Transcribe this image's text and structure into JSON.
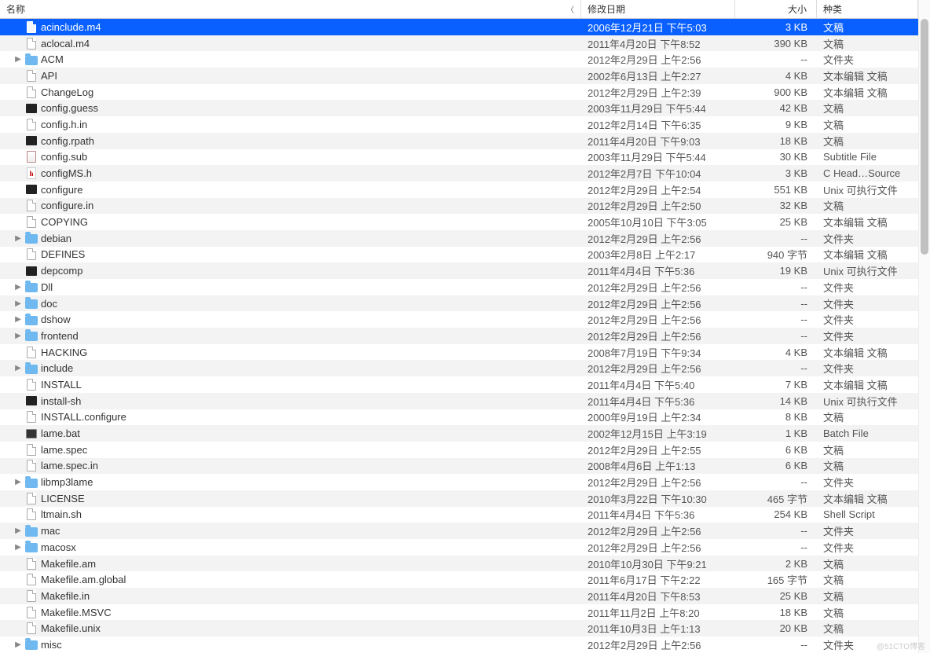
{
  "columns": {
    "name": "名称",
    "date": "修改日期",
    "size": "大小",
    "kind": "种类"
  },
  "watermark": "@51CTO博客",
  "files": [
    {
      "name": "acinclude.m4",
      "date": "2006年12月21日 下午5:03",
      "size": "3 KB",
      "kind": "文稿",
      "icon": "doc",
      "folder": false,
      "selected": true
    },
    {
      "name": "aclocal.m4",
      "date": "2011年4月20日 下午8:52",
      "size": "390 KB",
      "kind": "文稿",
      "icon": "doc",
      "folder": false
    },
    {
      "name": "ACM",
      "date": "2012年2月29日 上午2:56",
      "size": "--",
      "kind": "文件夹",
      "icon": "folder",
      "folder": true
    },
    {
      "name": "API",
      "date": "2002年6月13日 上午2:27",
      "size": "4 KB",
      "kind": "文本编辑 文稿",
      "icon": "doc",
      "folder": false
    },
    {
      "name": "ChangeLog",
      "date": "2012年2月29日 上午2:39",
      "size": "900 KB",
      "kind": "文本编辑 文稿",
      "icon": "doc",
      "folder": false
    },
    {
      "name": "config.guess",
      "date": "2003年11月29日 下午5:44",
      "size": "42 KB",
      "kind": "文稿",
      "icon": "exec",
      "folder": false
    },
    {
      "name": "config.h.in",
      "date": "2012年2月14日 下午6:35",
      "size": "9 KB",
      "kind": "文稿",
      "icon": "doc",
      "folder": false
    },
    {
      "name": "config.rpath",
      "date": "2011年4月20日 下午9:03",
      "size": "18 KB",
      "kind": "文稿",
      "icon": "exec",
      "folder": false
    },
    {
      "name": "config.sub",
      "date": "2003年11月29日 下午5:44",
      "size": "30 KB",
      "kind": "Subtitle File",
      "icon": "sub",
      "folder": false
    },
    {
      "name": "configMS.h",
      "date": "2012年2月7日 下午10:04",
      "size": "3 KB",
      "kind": "C Head…Source",
      "icon": "h",
      "folder": false
    },
    {
      "name": "configure",
      "date": "2012年2月29日 上午2:54",
      "size": "551 KB",
      "kind": "Unix 可执行文件",
      "icon": "exec",
      "folder": false
    },
    {
      "name": "configure.in",
      "date": "2012年2月29日 上午2:50",
      "size": "32 KB",
      "kind": "文稿",
      "icon": "doc",
      "folder": false
    },
    {
      "name": "COPYING",
      "date": "2005年10月10日 下午3:05",
      "size": "25 KB",
      "kind": "文本编辑 文稿",
      "icon": "doc",
      "folder": false
    },
    {
      "name": "debian",
      "date": "2012年2月29日 上午2:56",
      "size": "--",
      "kind": "文件夹",
      "icon": "folder",
      "folder": true
    },
    {
      "name": "DEFINES",
      "date": "2003年2月8日 上午2:17",
      "size": "940 字节",
      "kind": "文本编辑 文稿",
      "icon": "doc",
      "folder": false
    },
    {
      "name": "depcomp",
      "date": "2011年4月4日 下午5:36",
      "size": "19 KB",
      "kind": "Unix 可执行文件",
      "icon": "exec",
      "folder": false
    },
    {
      "name": "Dll",
      "date": "2012年2月29日 上午2:56",
      "size": "--",
      "kind": "文件夹",
      "icon": "folder",
      "folder": true
    },
    {
      "name": "doc",
      "date": "2012年2月29日 上午2:56",
      "size": "--",
      "kind": "文件夹",
      "icon": "folder",
      "folder": true
    },
    {
      "name": "dshow",
      "date": "2012年2月29日 上午2:56",
      "size": "--",
      "kind": "文件夹",
      "icon": "folder",
      "folder": true
    },
    {
      "name": "frontend",
      "date": "2012年2月29日 上午2:56",
      "size": "--",
      "kind": "文件夹",
      "icon": "folder",
      "folder": true
    },
    {
      "name": "HACKING",
      "date": "2008年7月19日 下午9:34",
      "size": "4 KB",
      "kind": "文本编辑 文稿",
      "icon": "doc",
      "folder": false
    },
    {
      "name": "include",
      "date": "2012年2月29日 上午2:56",
      "size": "--",
      "kind": "文件夹",
      "icon": "folder",
      "folder": true
    },
    {
      "name": "INSTALL",
      "date": "2011年4月4日 下午5:40",
      "size": "7 KB",
      "kind": "文本编辑 文稿",
      "icon": "doc",
      "folder": false
    },
    {
      "name": "install-sh",
      "date": "2011年4月4日 下午5:36",
      "size": "14 KB",
      "kind": "Unix 可执行文件",
      "icon": "exec",
      "folder": false
    },
    {
      "name": "INSTALL.configure",
      "date": "2000年9月19日 上午2:34",
      "size": "8 KB",
      "kind": "文稿",
      "icon": "doc",
      "folder": false
    },
    {
      "name": "lame.bat",
      "date": "2002年12月15日 上午3:19",
      "size": "1 KB",
      "kind": "Batch File",
      "icon": "bat",
      "folder": false
    },
    {
      "name": "lame.spec",
      "date": "2012年2月29日 上午2:55",
      "size": "6 KB",
      "kind": "文稿",
      "icon": "doc",
      "folder": false
    },
    {
      "name": "lame.spec.in",
      "date": "2008年4月6日 上午1:13",
      "size": "6 KB",
      "kind": "文稿",
      "icon": "doc",
      "folder": false
    },
    {
      "name": "libmp3lame",
      "date": "2012年2月29日 上午2:56",
      "size": "--",
      "kind": "文件夹",
      "icon": "folder",
      "folder": true
    },
    {
      "name": "LICENSE",
      "date": "2010年3月22日 下午10:30",
      "size": "465 字节",
      "kind": "文本编辑 文稿",
      "icon": "doc",
      "folder": false
    },
    {
      "name": "ltmain.sh",
      "date": "2011年4月4日 下午5:36",
      "size": "254 KB",
      "kind": "Shell Script",
      "icon": "doc",
      "folder": false
    },
    {
      "name": "mac",
      "date": "2012年2月29日 上午2:56",
      "size": "--",
      "kind": "文件夹",
      "icon": "folder",
      "folder": true
    },
    {
      "name": "macosx",
      "date": "2012年2月29日 上午2:56",
      "size": "--",
      "kind": "文件夹",
      "icon": "folder",
      "folder": true
    },
    {
      "name": "Makefile.am",
      "date": "2010年10月30日 下午9:21",
      "size": "2 KB",
      "kind": "文稿",
      "icon": "doc",
      "folder": false
    },
    {
      "name": "Makefile.am.global",
      "date": "2011年6月17日 下午2:22",
      "size": "165 字节",
      "kind": "文稿",
      "icon": "doc",
      "folder": false
    },
    {
      "name": "Makefile.in",
      "date": "2011年4月20日 下午8:53",
      "size": "25 KB",
      "kind": "文稿",
      "icon": "doc",
      "folder": false
    },
    {
      "name": "Makefile.MSVC",
      "date": "2011年11月2日 上午8:20",
      "size": "18 KB",
      "kind": "文稿",
      "icon": "doc",
      "folder": false
    },
    {
      "name": "Makefile.unix",
      "date": "2011年10月3日 上午1:13",
      "size": "20 KB",
      "kind": "文稿",
      "icon": "doc",
      "folder": false
    },
    {
      "name": "misc",
      "date": "2012年2月29日 上午2:56",
      "size": "--",
      "kind": "文件夹",
      "icon": "folder",
      "folder": true
    }
  ]
}
